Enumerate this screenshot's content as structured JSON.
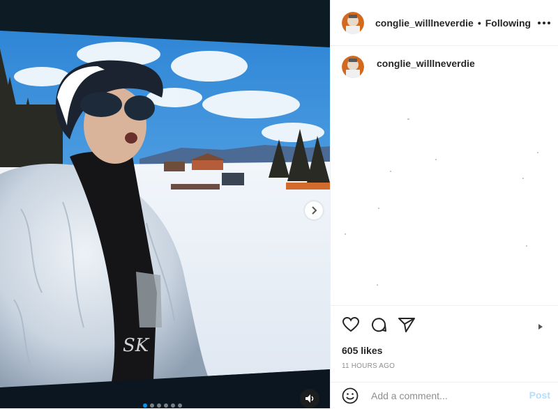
{
  "post": {
    "username": "conglie_willlneverdie",
    "follow_label": "Following",
    "separator": "•",
    "caption_username": "conglie_willlneverdie",
    "likes": "605 likes",
    "timestamp": "11 HOURS AGO"
  },
  "comment": {
    "placeholder": "Add a comment...",
    "post_label": "Post"
  },
  "media": {
    "watermark": "SK",
    "carousel_dots": 6,
    "active_dot": 0
  },
  "icons": {
    "more": "more-options-icon",
    "like": "heart-icon",
    "comment": "comment-icon",
    "share": "share-icon",
    "save": "save-icon",
    "next": "chevron-right-icon",
    "sound": "speaker-icon",
    "emoji": "emoji-icon"
  },
  "colors": {
    "accent": "#0095f6",
    "post_disabled": "#b2dffc",
    "text": "#262626",
    "secondary": "#8e8e8e"
  }
}
